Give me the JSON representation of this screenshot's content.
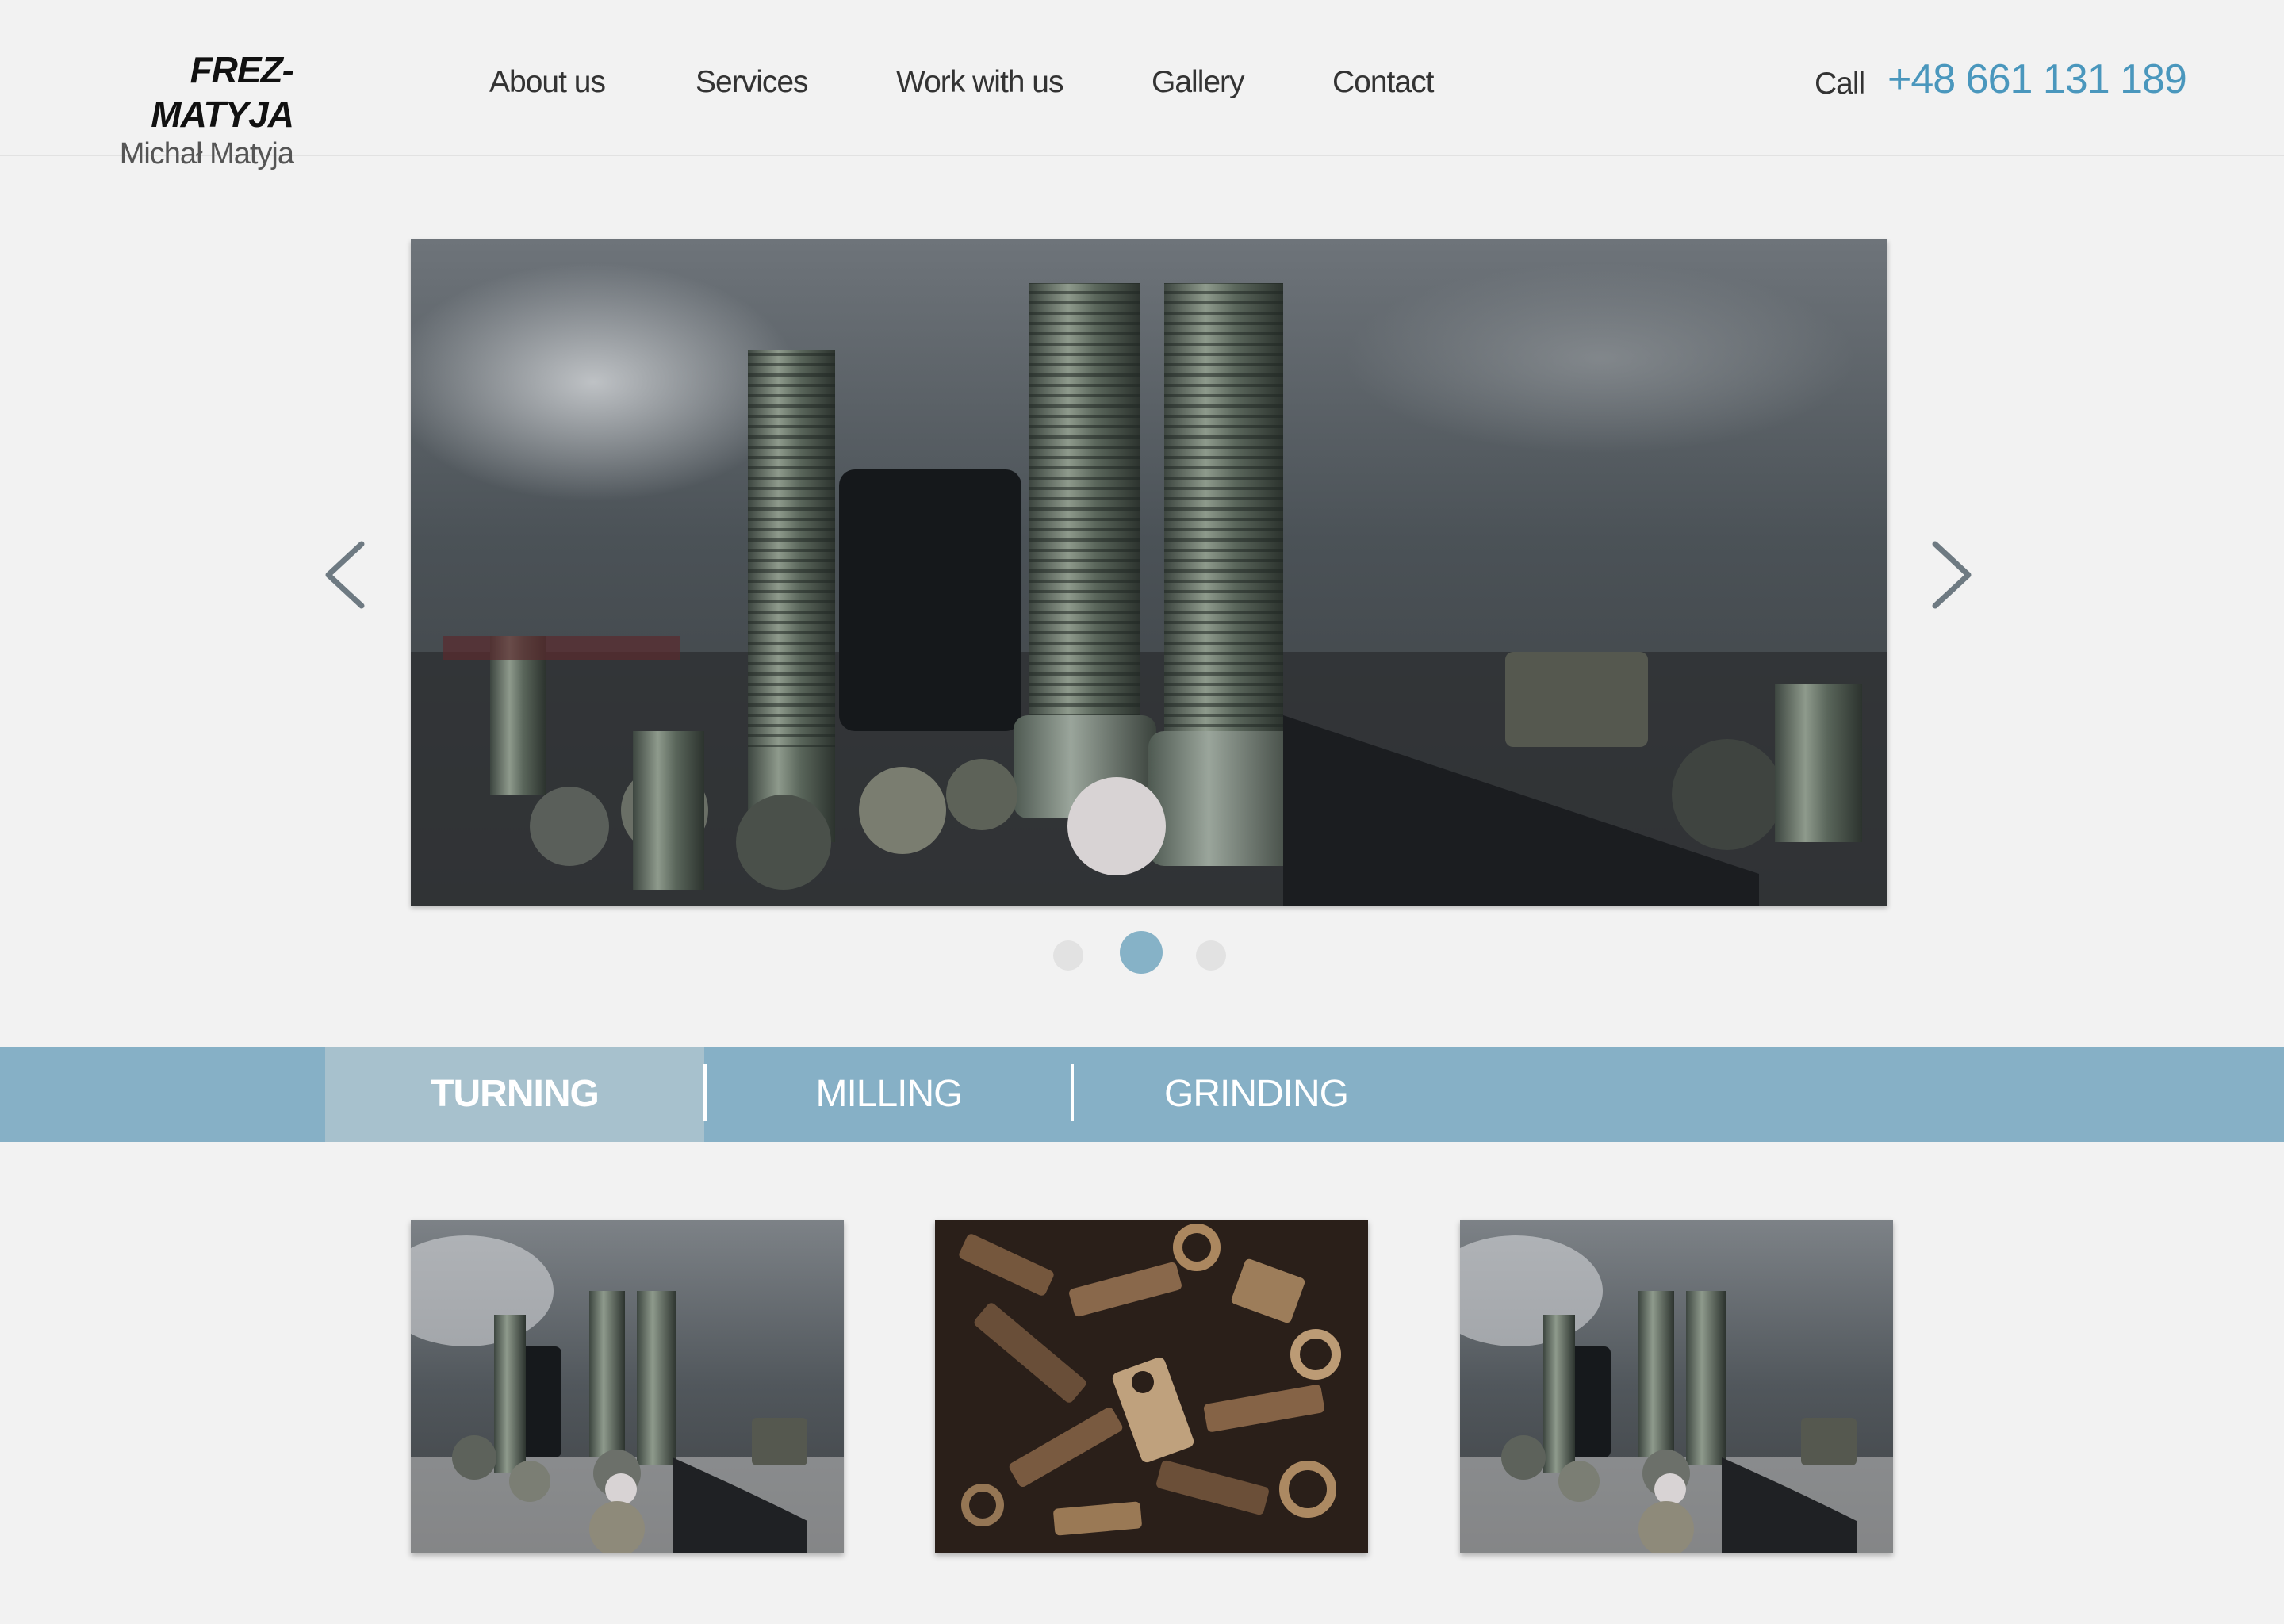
{
  "brand": {
    "name": "FREZ-MATYJA",
    "owner": "Michał Matyja"
  },
  "nav": {
    "items": [
      {
        "label": "About us"
      },
      {
        "label": "Services"
      },
      {
        "label": "Work with us"
      },
      {
        "label": "Gallery"
      },
      {
        "label": "Contact"
      }
    ]
  },
  "contact": {
    "call_label": "Call",
    "phone": "+48 661 131 189"
  },
  "slider": {
    "slide_count": 3,
    "active_slide": 2,
    "main_image_icon": "bolts-photo",
    "prev_icon": "chevron-left-icon",
    "next_icon": "chevron-right-icon"
  },
  "tabs": {
    "items": [
      {
        "label": "TURNING",
        "active": true
      },
      {
        "label": "MILLING",
        "active": false
      },
      {
        "label": "GRINDING",
        "active": false
      }
    ]
  },
  "gallery": {
    "thumbnails": [
      {
        "icon": "bolts-photo"
      },
      {
        "icon": "hardware-pile-photo"
      },
      {
        "icon": "bolts-photo"
      }
    ]
  },
  "colors": {
    "background": "#f2f2f2",
    "accent": "#4a97bd",
    "tab_band": "#86b0c6",
    "tab_active": "#a7c1cd",
    "dot_active": "#86b2c7",
    "dot_inactive": "#e2e2e2"
  }
}
